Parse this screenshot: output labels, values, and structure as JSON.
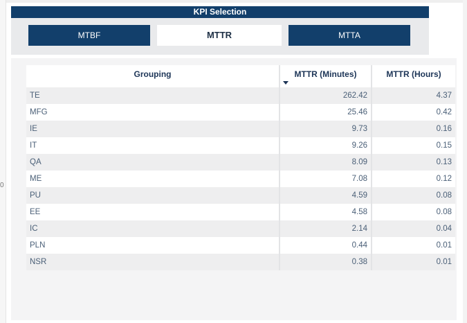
{
  "kpi_selection": {
    "title": "KPI Selection",
    "buttons": [
      {
        "label": "MTBF",
        "active": false
      },
      {
        "label": "MTTR",
        "active": true
      },
      {
        "label": "MTTA",
        "active": false
      }
    ]
  },
  "table": {
    "headers": {
      "grouping": "Grouping",
      "minutes": "MTTR (Minutes)",
      "hours": "MTTR (Hours)"
    },
    "sorted_by": "MTTR (Minutes)",
    "sort_direction": "descending",
    "rows": [
      {
        "group": "TE",
        "minutes": "262.42",
        "hours": "4.37"
      },
      {
        "group": "MFG",
        "minutes": "25.46",
        "hours": "0.42"
      },
      {
        "group": "IE",
        "minutes": "9.73",
        "hours": "0.16"
      },
      {
        "group": "IT",
        "minutes": "9.26",
        "hours": "0.15"
      },
      {
        "group": "QA",
        "minutes": "8.09",
        "hours": "0.13"
      },
      {
        "group": "ME",
        "minutes": "7.08",
        "hours": "0.12"
      },
      {
        "group": "PU",
        "minutes": "4.59",
        "hours": "0.08"
      },
      {
        "group": "EE",
        "minutes": "4.58",
        "hours": "0.08"
      },
      {
        "group": "IC",
        "minutes": "2.14",
        "hours": "0.04"
      },
      {
        "group": "PLN",
        "minutes": "0.44",
        "hours": "0.01"
      },
      {
        "group": "NSR",
        "minutes": "0.38",
        "hours": "0.01"
      }
    ]
  },
  "edge_glyph": "0",
  "colors": {
    "header_navy": "#123f6b",
    "panel_gray": "#e9eaec",
    "row_stripe": "#eeeeef",
    "text_blue": "#4a5f77"
  }
}
